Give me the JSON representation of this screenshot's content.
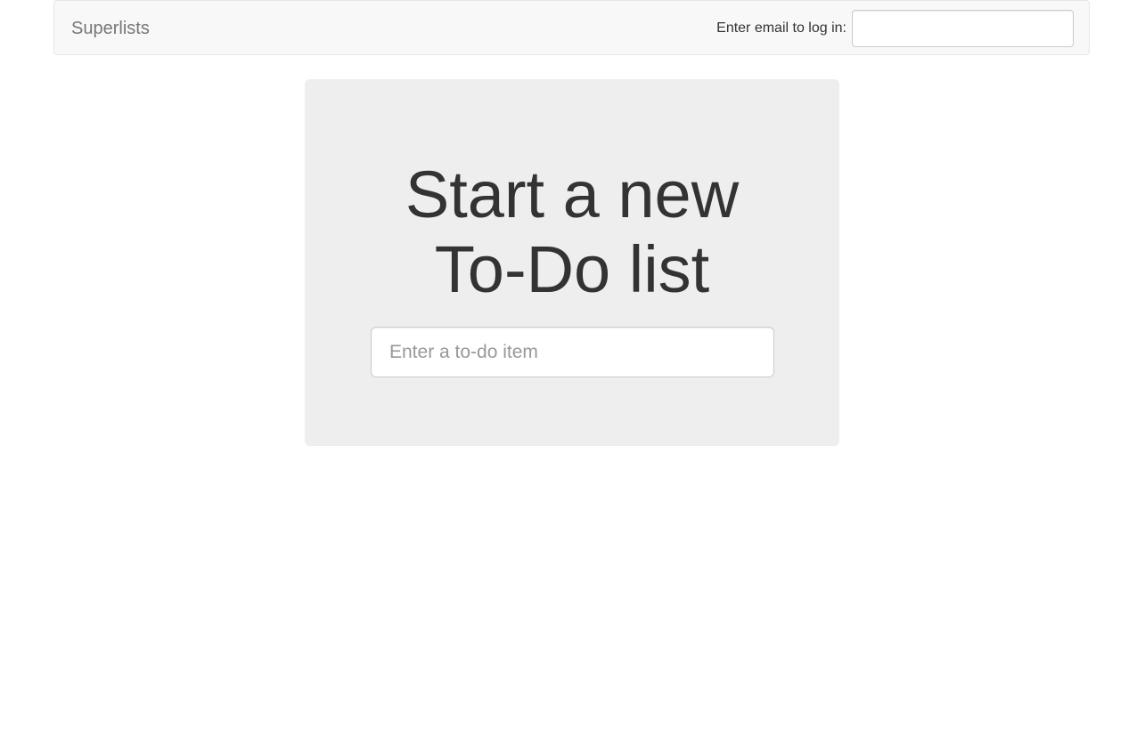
{
  "navbar": {
    "brand": "Superlists",
    "login_label": "Enter email to log in:",
    "email_value": ""
  },
  "main": {
    "title_line1": "Start a new",
    "title_line2": "To-Do list",
    "todo_placeholder": "Enter a to-do item",
    "todo_value": ""
  },
  "colors": {
    "navbar_bg": "#f8f8f8",
    "jumbotron_bg": "#eeeeee",
    "text": "#333333",
    "brand": "#777777"
  }
}
